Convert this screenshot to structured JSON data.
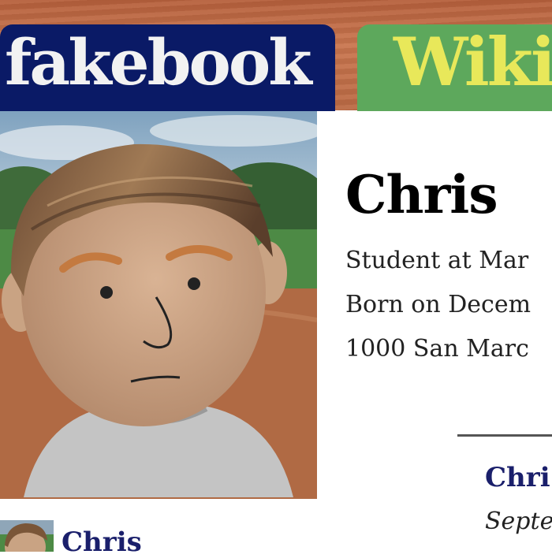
{
  "nav": {
    "tabs": [
      {
        "label": "fakebook"
      },
      {
        "label": "Wiki"
      }
    ]
  },
  "profile": {
    "name": "Chris",
    "info": [
      "Student at Mar",
      "Born on Decem",
      "1000 San Marc"
    ]
  },
  "feed": {
    "post_author": "Chri",
    "post_date": "Septe"
  },
  "friends": {
    "items": [
      {
        "name": "Chris"
      }
    ]
  }
}
